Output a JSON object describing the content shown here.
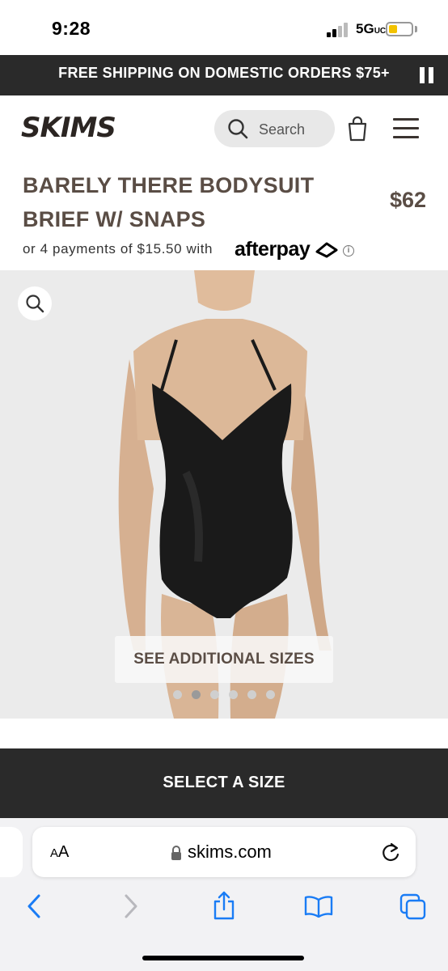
{
  "status_bar": {
    "time": "9:28",
    "network": "5G",
    "network_suffix": "UC"
  },
  "promo": {
    "text": "FREE SHIPPING ON DOMESTIC ORDERS $75+"
  },
  "header": {
    "logo": "SKIMS",
    "search_placeholder": "Search"
  },
  "product": {
    "title": "BARELY THERE BODYSUIT BRIEF W/ SNAPS",
    "price": "$62",
    "afterpay_text": "or 4 payments of $15.50 with",
    "afterpay_brand": "afterpay",
    "image_count": 6,
    "active_image_index": 1,
    "see_sizes_label": "SEE ADDITIONAL SIZES"
  },
  "cta": {
    "select_size_label": "SELECT A SIZE"
  },
  "browser": {
    "aa_label": "AA",
    "url": "skims.com"
  },
  "colors": {
    "promo_bg": "#2a2a2a",
    "title_brown": "#5a4d45",
    "safari_blue": "#1a7cf5"
  },
  "icons": [
    "search-icon",
    "bag-icon",
    "menu-icon",
    "pause-icon",
    "zoom-icon",
    "lock-icon",
    "reload-icon",
    "back-icon",
    "forward-icon",
    "share-icon",
    "bookmarks-icon",
    "tabs-icon"
  ]
}
